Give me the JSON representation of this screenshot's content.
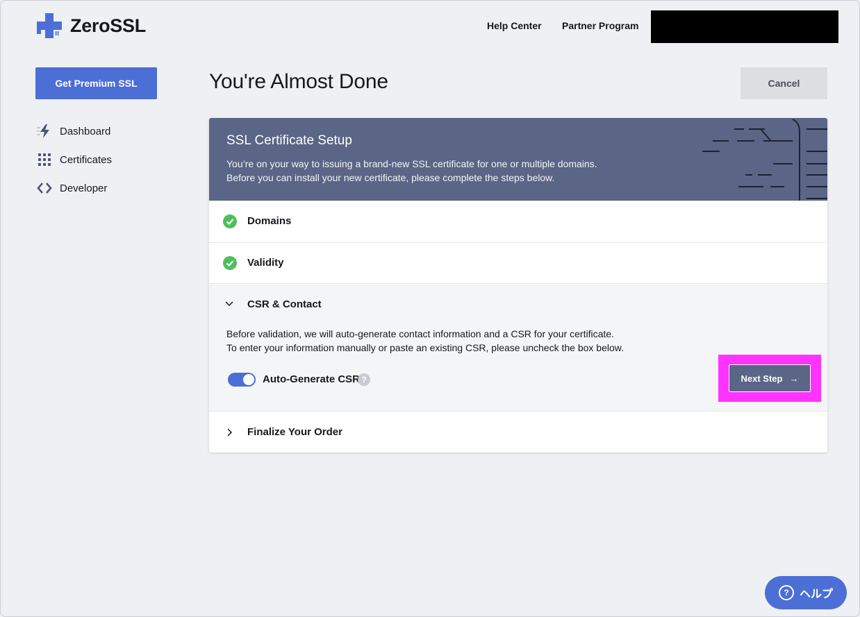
{
  "header": {
    "brand": "ZeroSSL",
    "nav": {
      "help_center": "Help Center",
      "partner_program": "Partner Program"
    }
  },
  "sidebar": {
    "premium_button": "Get Premium SSL",
    "items": [
      {
        "label": "Dashboard",
        "icon": "bolt-icon"
      },
      {
        "label": "Certificates",
        "icon": "grid-icon"
      },
      {
        "label": "Developer",
        "icon": "code-icon"
      }
    ]
  },
  "main": {
    "title": "You're Almost Done",
    "cancel_label": "Cancel",
    "card": {
      "title": "SSL Certificate Setup",
      "desc_line1": "You’re on your way to issuing a brand-new SSL certificate for one or multiple domains.",
      "desc_line2": "Before you can install your new certificate, please complete the steps below.",
      "steps": {
        "domains": "Domains",
        "validity": "Validity",
        "csr": "CSR & Contact",
        "final": "Finalize Your Order"
      },
      "csr_text_line1": "Before validation, we will auto-generate contact information and a CSR for your certificate.",
      "csr_text_line2": "To enter your information manually or paste an existing CSR, please uncheck the box below.",
      "toggle_label": "Auto-Generate CSR",
      "toggle_on": true,
      "help_mark": "?",
      "next_label": "Next Step",
      "next_arrow": "→"
    }
  },
  "help_fab": {
    "q": "?",
    "label": "ヘルプ"
  },
  "colors": {
    "accent": "#4c6fd6",
    "header_band": "#5b6585",
    "success": "#4cc05a",
    "highlight": "#ff33ff"
  }
}
